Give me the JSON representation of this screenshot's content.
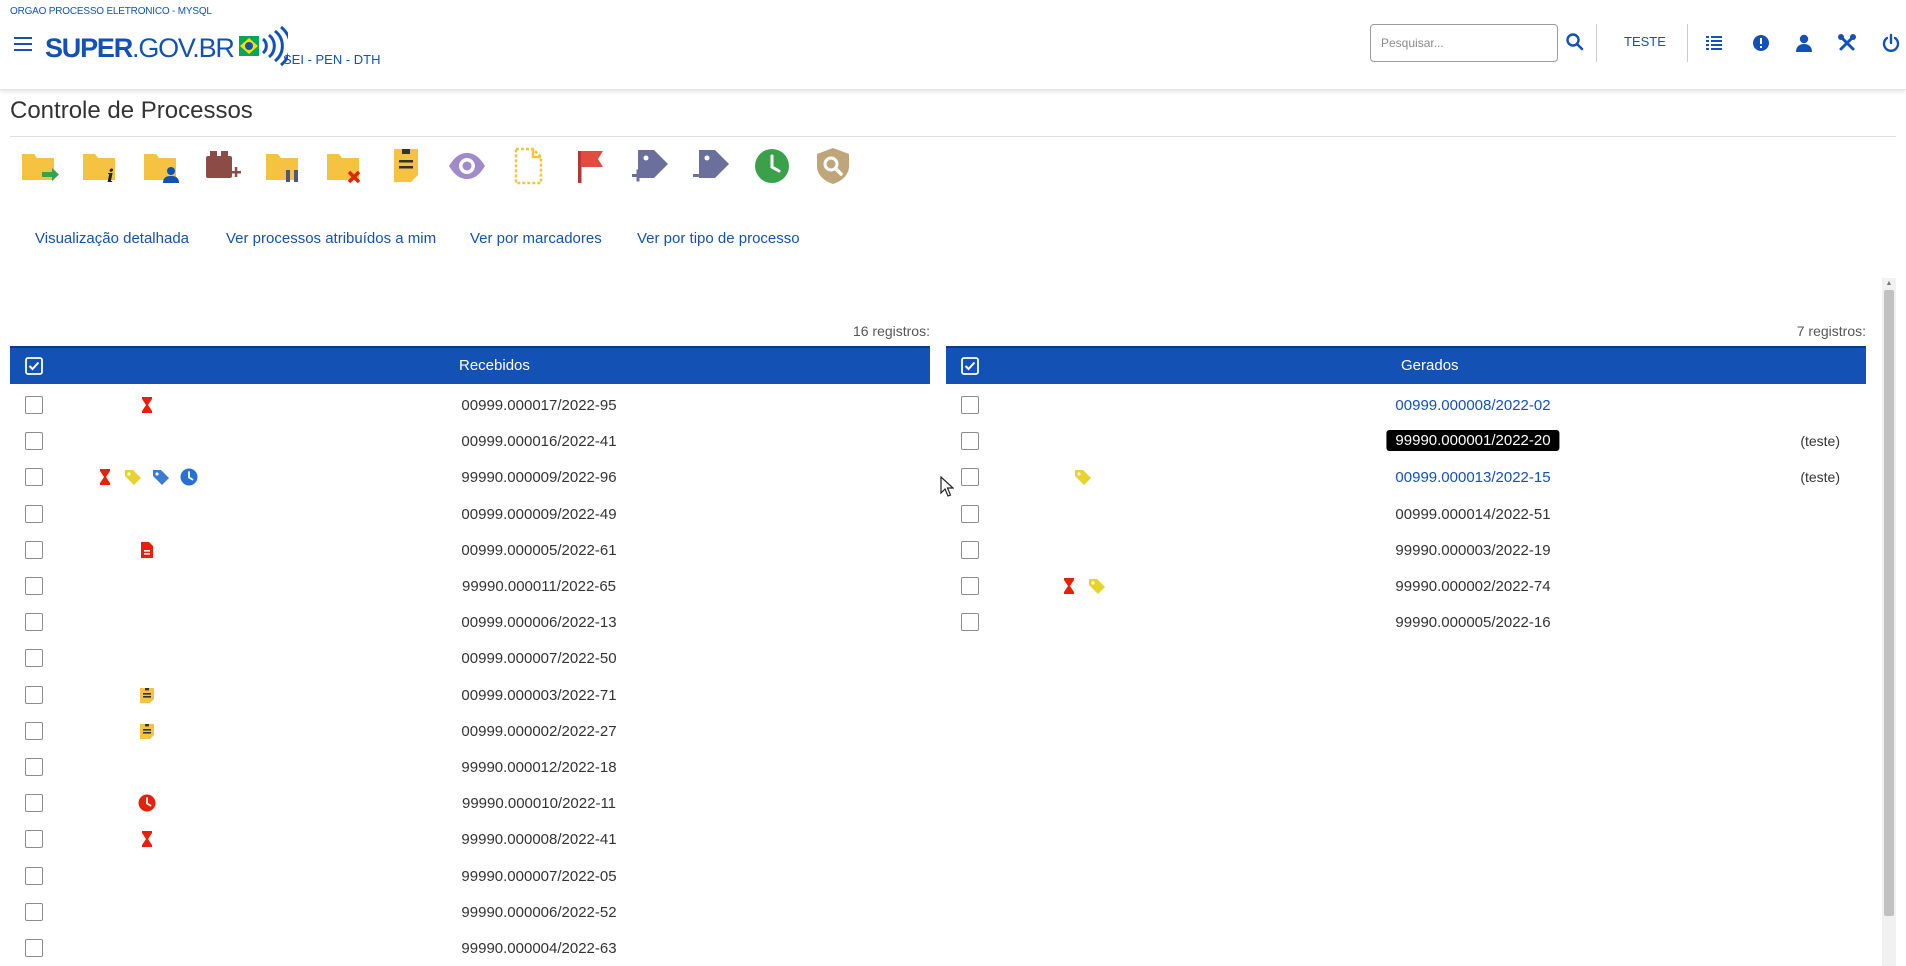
{
  "header": {
    "org_name": "ORGAO PROCESSO ELETRONICO - MYSQL",
    "logo_text_bold": "SUPER",
    "logo_text_rest": ".GOV.BR",
    "system_name": "SEI - PEN - DTH",
    "search_placeholder": "Pesquisar...",
    "unit_label": "TESTE",
    "icons": [
      "menu-icon",
      "search-icon",
      "list-icon",
      "alert-icon",
      "user-icon",
      "tools-icon",
      "power-icon"
    ]
  },
  "page": {
    "title": "Controle de Processos"
  },
  "toolbar": {
    "icons": [
      "send-process-icon",
      "process-info-icon",
      "assign-process-icon",
      "new-relationship-icon",
      "pause-process-icon",
      "close-process-icon",
      "note-icon",
      "mark-visualized-icon",
      "new-document-icon",
      "flag-icon",
      "add-marker-icon",
      "remove-marker-icon",
      "deadline-icon",
      "search-shield-icon"
    ],
    "colors": {
      "folder": "#f5c242",
      "brown": "#8c4b45",
      "purple": "#a08ac9",
      "red": "#e04d40",
      "slate": "#6a6f9b",
      "green": "#3aa14a",
      "khaki": "#bfa67a"
    }
  },
  "view_links": [
    "Visualização detalhada",
    "Ver processos atribuídos a mim",
    "Ver por marcadores",
    "Ver por tipo de processo"
  ],
  "received": {
    "count_text": "16 registros:",
    "header": "Recebidos",
    "rows": [
      {
        "process": "00999.000017/2022-95",
        "icons": [
          "hourglass-icon"
        ]
      },
      {
        "process": "00999.000016/2022-41",
        "icons": []
      },
      {
        "process": "99990.000009/2022-96",
        "icons": [
          "hourglass-icon",
          "yellow-tag-icon",
          "blue-tag-icon",
          "clock-blue-icon"
        ]
      },
      {
        "process": "00999.000009/2022-49",
        "icons": []
      },
      {
        "process": "00999.000005/2022-61",
        "icons": [
          "red-document-icon"
        ]
      },
      {
        "process": "99990.000011/2022-65",
        "icons": []
      },
      {
        "process": "00999.000006/2022-13",
        "icons": []
      },
      {
        "process": "00999.000007/2022-50",
        "icons": []
      },
      {
        "process": "00999.000003/2022-71",
        "icons": [
          "note-icon"
        ]
      },
      {
        "process": "00999.000002/2022-27",
        "icons": [
          "note-icon"
        ]
      },
      {
        "process": "99990.000012/2022-18",
        "icons": []
      },
      {
        "process": "99990.000010/2022-11",
        "icons": [
          "clock-red-icon"
        ]
      },
      {
        "process": "99990.000008/2022-41",
        "icons": [
          "hourglass-icon"
        ]
      },
      {
        "process": "99990.000007/2022-05",
        "icons": []
      },
      {
        "process": "99990.000006/2022-52",
        "icons": []
      },
      {
        "process": "99990.000004/2022-63",
        "icons": []
      }
    ]
  },
  "generated": {
    "count_text": "7 registros:",
    "header": "Gerados",
    "rows": [
      {
        "process": "00999.000008/2022-02",
        "style": "link",
        "note": "",
        "icons": []
      },
      {
        "process": "99990.000001/2022-20",
        "style": "highlight",
        "note": "(teste)",
        "icons": []
      },
      {
        "process": "00999.000013/2022-15",
        "style": "link",
        "note": "(teste)",
        "icons": [
          "yellow-tag-icon"
        ]
      },
      {
        "process": "00999.000014/2022-51",
        "style": "normal",
        "note": "",
        "icons": []
      },
      {
        "process": "99990.000003/2022-19",
        "style": "normal",
        "note": "",
        "icons": []
      },
      {
        "process": "99990.000002/2022-74",
        "style": "normal",
        "note": "",
        "icons": [
          "hourglass-icon",
          "yellow-tag-icon"
        ]
      },
      {
        "process": "99990.000005/2022-16",
        "style": "normal",
        "note": "",
        "icons": []
      }
    ]
  },
  "colors": {
    "primary": "#1351b4",
    "hourglass": "#e52207",
    "tag_yellow": "#e8d22c",
    "tag_blue": "#3a7bd5",
    "clock_blue": "#2a6fd6",
    "clock_red": "#e52207",
    "note_yellow": "#f5c242"
  }
}
